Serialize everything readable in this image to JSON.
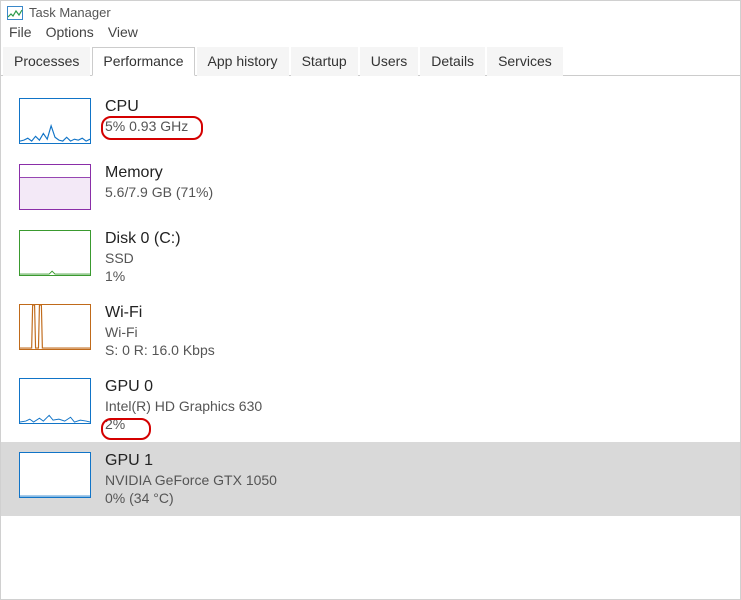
{
  "window": {
    "title": "Task Manager"
  },
  "menu": {
    "file": "File",
    "options": "Options",
    "view": "View"
  },
  "tabs": {
    "processes": "Processes",
    "performance": "Performance",
    "app_history": "App history",
    "startup": "Startup",
    "users": "Users",
    "details": "Details",
    "services": "Services",
    "active": "performance"
  },
  "perf": {
    "cpu": {
      "title": "CPU",
      "line1": "5% 0.93 GHz",
      "color": "#1174c7"
    },
    "memory": {
      "title": "Memory",
      "line1": "5.6/7.9 GB (71%)",
      "color": "#8a2ea8"
    },
    "disk0": {
      "title": "Disk 0 (C:)",
      "line1": "SSD",
      "line2": "1%",
      "color": "#3a9a2f"
    },
    "wifi": {
      "title": "Wi-Fi",
      "line1": "Wi-Fi",
      "line2": "S: 0 R: 16.0 Kbps",
      "color": "#c06a1a"
    },
    "gpu0": {
      "title": "GPU 0",
      "line1": "Intel(R) HD Graphics 630",
      "line2": "2%",
      "color": "#1174c7"
    },
    "gpu1": {
      "title": "GPU 1",
      "line1": "NVIDIA GeForce GTX 1050",
      "line2": "0%  (34 °C)",
      "color": "#1174c7"
    }
  },
  "chart_data": [
    {
      "type": "line",
      "name": "CPU",
      "x": [
        0,
        1,
        2,
        3,
        4,
        5,
        6,
        7,
        8,
        9,
        10,
        11,
        12,
        13,
        14,
        15,
        16,
        17,
        18,
        19
      ],
      "values": [
        4,
        3,
        6,
        2,
        10,
        4,
        16,
        5,
        30,
        8,
        5,
        3,
        7,
        2,
        5,
        3,
        6,
        2,
        4,
        3
      ],
      "ylim": [
        0,
        100
      ]
    },
    {
      "type": "area",
      "name": "Memory",
      "x": [
        0,
        1,
        2,
        3,
        4,
        5,
        6,
        7,
        8,
        9,
        10,
        11,
        12,
        13,
        14,
        15,
        16,
        17,
        18,
        19
      ],
      "values": [
        71,
        71,
        71,
        71,
        71,
        71,
        71,
        71,
        71,
        71,
        71,
        71,
        71,
        71,
        71,
        71,
        71,
        71,
        71,
        71
      ],
      "ylim": [
        0,
        100
      ]
    },
    {
      "type": "line",
      "name": "Disk 0",
      "x": [
        0,
        1,
        2,
        3,
        4,
        5,
        6,
        7,
        8,
        9,
        10,
        11,
        12,
        13,
        14,
        15,
        16,
        17,
        18,
        19
      ],
      "values": [
        0,
        0,
        0,
        0,
        0,
        0,
        0,
        0,
        0,
        4,
        0,
        0,
        0,
        0,
        0,
        0,
        0,
        0,
        0,
        0
      ],
      "ylim": [
        0,
        100
      ]
    },
    {
      "type": "line",
      "name": "Wi-Fi",
      "x": [
        0,
        1,
        2,
        3,
        4,
        5,
        6,
        7,
        8,
        9,
        10,
        11,
        12,
        13,
        14,
        15,
        16,
        17,
        18,
        19
      ],
      "values": [
        0,
        0,
        0,
        100,
        0,
        100,
        0,
        0,
        0,
        0,
        0,
        0,
        0,
        0,
        0,
        0,
        0,
        0,
        0,
        0
      ],
      "ylim": [
        0,
        100
      ]
    },
    {
      "type": "line",
      "name": "GPU 0",
      "x": [
        0,
        1,
        2,
        3,
        4,
        5,
        6,
        7,
        8,
        9,
        10,
        11,
        12,
        13,
        14,
        15,
        16,
        17,
        18,
        19
      ],
      "values": [
        2,
        1,
        4,
        1,
        6,
        2,
        10,
        3,
        5,
        2,
        8,
        2,
        4,
        1,
        3,
        1,
        6,
        2,
        3,
        1
      ],
      "ylim": [
        0,
        100
      ]
    },
    {
      "type": "line",
      "name": "GPU 1",
      "x": [
        0,
        1,
        2,
        3,
        4,
        5,
        6,
        7,
        8,
        9,
        10,
        11,
        12,
        13,
        14,
        15,
        16,
        17,
        18,
        19
      ],
      "values": [
        0,
        0,
        0,
        0,
        0,
        0,
        0,
        0,
        0,
        0,
        0,
        0,
        0,
        0,
        0,
        0,
        0,
        0,
        0,
        0
      ],
      "ylim": [
        0,
        100
      ]
    }
  ]
}
